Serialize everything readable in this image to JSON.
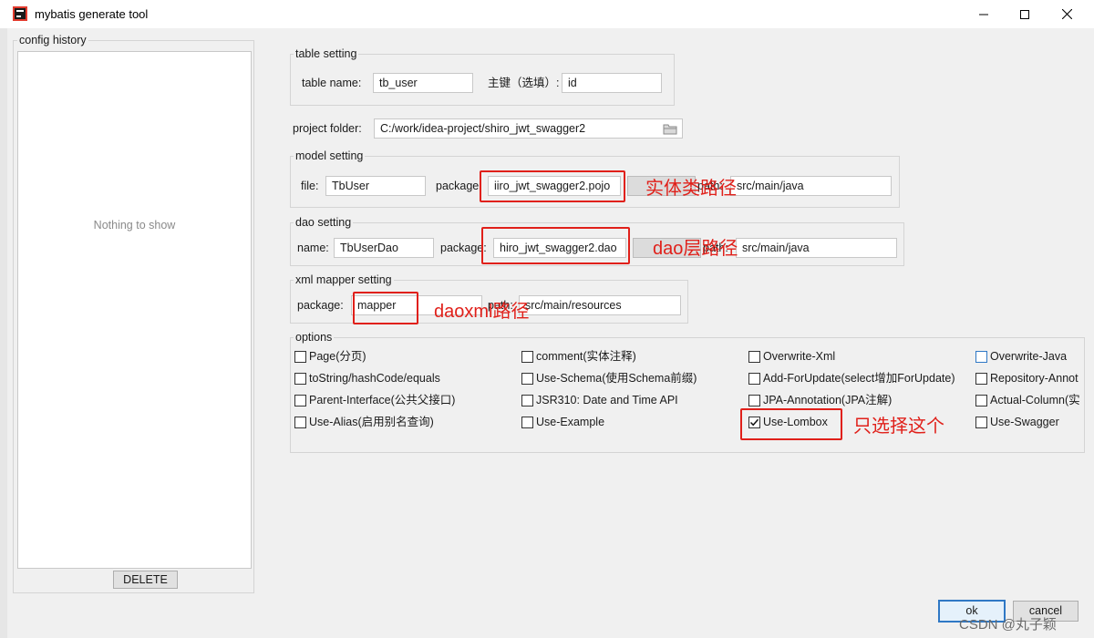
{
  "window": {
    "title": "mybatis generate tool"
  },
  "config_history": {
    "legend": "config history",
    "empty_text": "Nothing to show",
    "delete_label": "DELETE"
  },
  "table_setting": {
    "legend": "table setting",
    "table_name_label": "table  name:",
    "table_name_value": "tb_user",
    "pk_label": "主键（选填）:",
    "pk_value": "id"
  },
  "project": {
    "label": "project folder:",
    "value": "C:/work/idea-project/shiro_jwt_swagger2"
  },
  "model_setting": {
    "legend": "model setting",
    "file_label": "file:",
    "file_value": "TbUser",
    "package_label": "package:",
    "package_value": "iiro_jwt_swagger2.pojo",
    "path_label": "path:",
    "path_value": "src/main/java"
  },
  "dao_setting": {
    "legend": "dao setting",
    "name_label": "name:",
    "name_value": "TbUserDao",
    "package_label": "package:",
    "package_value": "hiro_jwt_swagger2.dao",
    "path_label": "path:",
    "path_value": "src/main/java"
  },
  "xml_setting": {
    "legend": "xml mapper setting",
    "package_label": "package:",
    "package_value": "mapper",
    "path_label": "path:",
    "path_value": "src/main/resources"
  },
  "options": {
    "legend": "options",
    "items": [
      {
        "label": "Page(分页)",
        "checked": false
      },
      {
        "label": "comment(实体注释)",
        "checked": false
      },
      {
        "label": "Overwrite-Xml",
        "checked": false
      },
      {
        "label": "Overwrite-Java",
        "checked": false
      },
      {
        "label": "toString/hashCode/equals",
        "checked": false
      },
      {
        "label": "Use-Schema(使用Schema前缀)",
        "checked": false
      },
      {
        "label": "Add-ForUpdate(select增加ForUpdate)",
        "checked": false
      },
      {
        "label": "Repository-Annot",
        "checked": false
      },
      {
        "label": "Parent-Interface(公共父接口)",
        "checked": false
      },
      {
        "label": "JSR310: Date and Time API",
        "checked": false
      },
      {
        "label": "JPA-Annotation(JPA注解)",
        "checked": false
      },
      {
        "label": "Actual-Column(实",
        "checked": false
      },
      {
        "label": "Use-Alias(启用别名查询)",
        "checked": false
      },
      {
        "label": "Use-Example",
        "checked": false
      },
      {
        "label": "Use-Lombox",
        "checked": true
      },
      {
        "label": "Use-Swagger",
        "checked": false
      }
    ]
  },
  "annotations": {
    "entity_path": "实体类路径",
    "dao_path": "dao层路径",
    "daoxml_path": "daoxml路径",
    "only_select": "只选择这个"
  },
  "footer": {
    "ok_label": "ok",
    "cancel_label": "cancel",
    "watermark": "CSDN @丸子颖"
  },
  "colors": {
    "annotation_red": "#e0201a",
    "focus_blue": "#2f78c5"
  }
}
